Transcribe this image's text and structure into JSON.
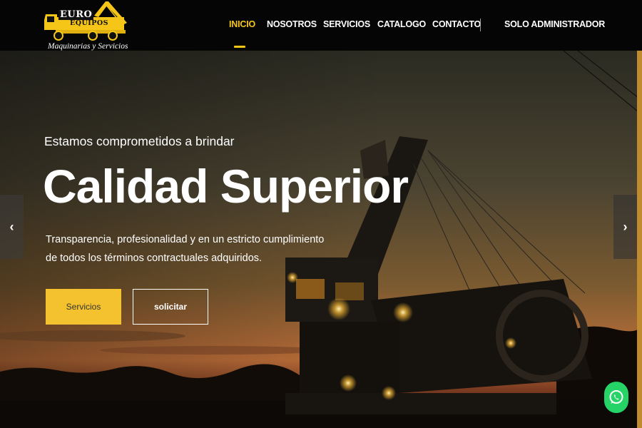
{
  "brand": {
    "logo_line1": "EURO",
    "logo_line2": "EQUIPOS",
    "tagline": "Maquinarias y Servicios"
  },
  "nav": {
    "items": [
      {
        "label": "INICIO",
        "active": true
      },
      {
        "label": "NOSOTROS",
        "active": false
      },
      {
        "label": "SERVICIOS",
        "active": false
      },
      {
        "label": "CATALOGO",
        "active": false
      },
      {
        "label": "CONTACTO",
        "active": false
      }
    ],
    "admin_label": "SOLO ADMINISTRADOR"
  },
  "hero": {
    "kicker": "Estamos comprometidos a brindar",
    "title": "Calidad Superior",
    "description": "Transparencia, profesionalidad y en un estricto cumplimiento de todos los términos contractuales adquiridos.",
    "primary_button": "Servicios",
    "secondary_button": "solicitar",
    "prev_arrow": "‹",
    "next_arrow": "›"
  },
  "icons": {
    "prev": "chevron-left-icon",
    "next": "chevron-right-icon",
    "chat": "whatsapp-icon",
    "logo": "crane-truck-icon"
  },
  "colors": {
    "accent": "#f4c22e",
    "header_bg": "#050505",
    "whatsapp": "#25d366"
  }
}
